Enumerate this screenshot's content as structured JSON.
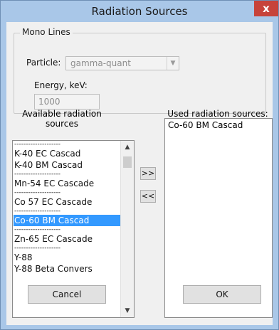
{
  "window": {
    "title": "Radiation Sources",
    "close_glyph": "x"
  },
  "mono_lines": {
    "legend": "Mono Lines",
    "particle_label": "Particle:",
    "particle_value": "gamma-quant",
    "energy_label": "Energy, keV:",
    "energy_value": "1000"
  },
  "available": {
    "label": "Available radiation sources",
    "items": [
      "--------------------",
      "K-40 EC Cascad",
      "K-40 BM Cascad",
      "--------------------",
      "Mn-54 EC Cascade",
      "--------------------",
      "Co 57 EC Cascade",
      "--------------------",
      "Co-60 BM Cascad",
      "--------------------",
      "Zn-65 EC Cascade",
      "--------------------",
      "Y-88",
      "Y-88 Beta Convers"
    ],
    "selected_index": 8
  },
  "used": {
    "label": "Used radiation sources:",
    "items": [
      "Co-60 BM Cascad"
    ]
  },
  "buttons": {
    "add": ">>",
    "remove": "<<",
    "cancel": "Cancel",
    "ok": "OK"
  },
  "icons": {
    "scroll_up": "chevron-up-icon",
    "scroll_down": "chevron-down-icon",
    "combo": "dropdown-arrow-icon"
  }
}
